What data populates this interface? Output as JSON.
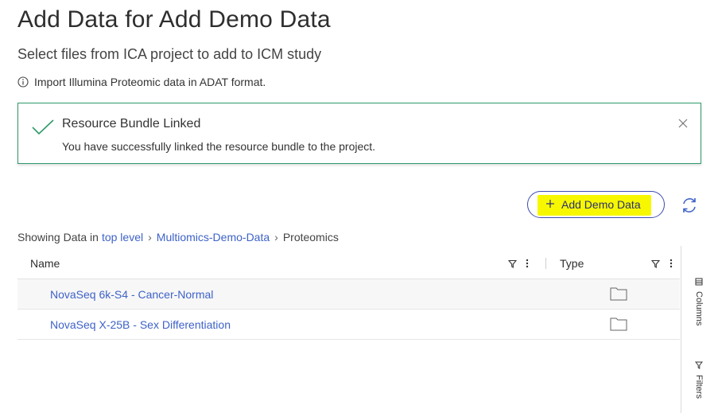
{
  "header": {
    "title": "Add Data for Add Demo Data",
    "subtitle": "Select files from ICA project to add to ICM study",
    "info": "Import Illumina Proteomic data in ADAT format."
  },
  "alert": {
    "title": "Resource Bundle Linked",
    "message": "You have successfully linked the resource bundle to the project.",
    "color": "#2f9a6b"
  },
  "toolbar": {
    "add_demo_label": "Add Demo Data",
    "highlight_color": "#f7f700"
  },
  "breadcrumb": {
    "prefix": "Showing Data in",
    "items": [
      "top level",
      "Multiomics-Demo-Data",
      "Proteomics"
    ]
  },
  "grid": {
    "columns": [
      "Name",
      "Type"
    ],
    "rows": [
      {
        "name": "NovaSeq 6k-S4 - Cancer-Normal",
        "type_icon": "folder-icon"
      },
      {
        "name": "NovaSeq X-25B - Sex Differentiation",
        "type_icon": "folder-icon"
      }
    ]
  },
  "side_panel": {
    "tabs": [
      "Columns",
      "Filters"
    ]
  }
}
